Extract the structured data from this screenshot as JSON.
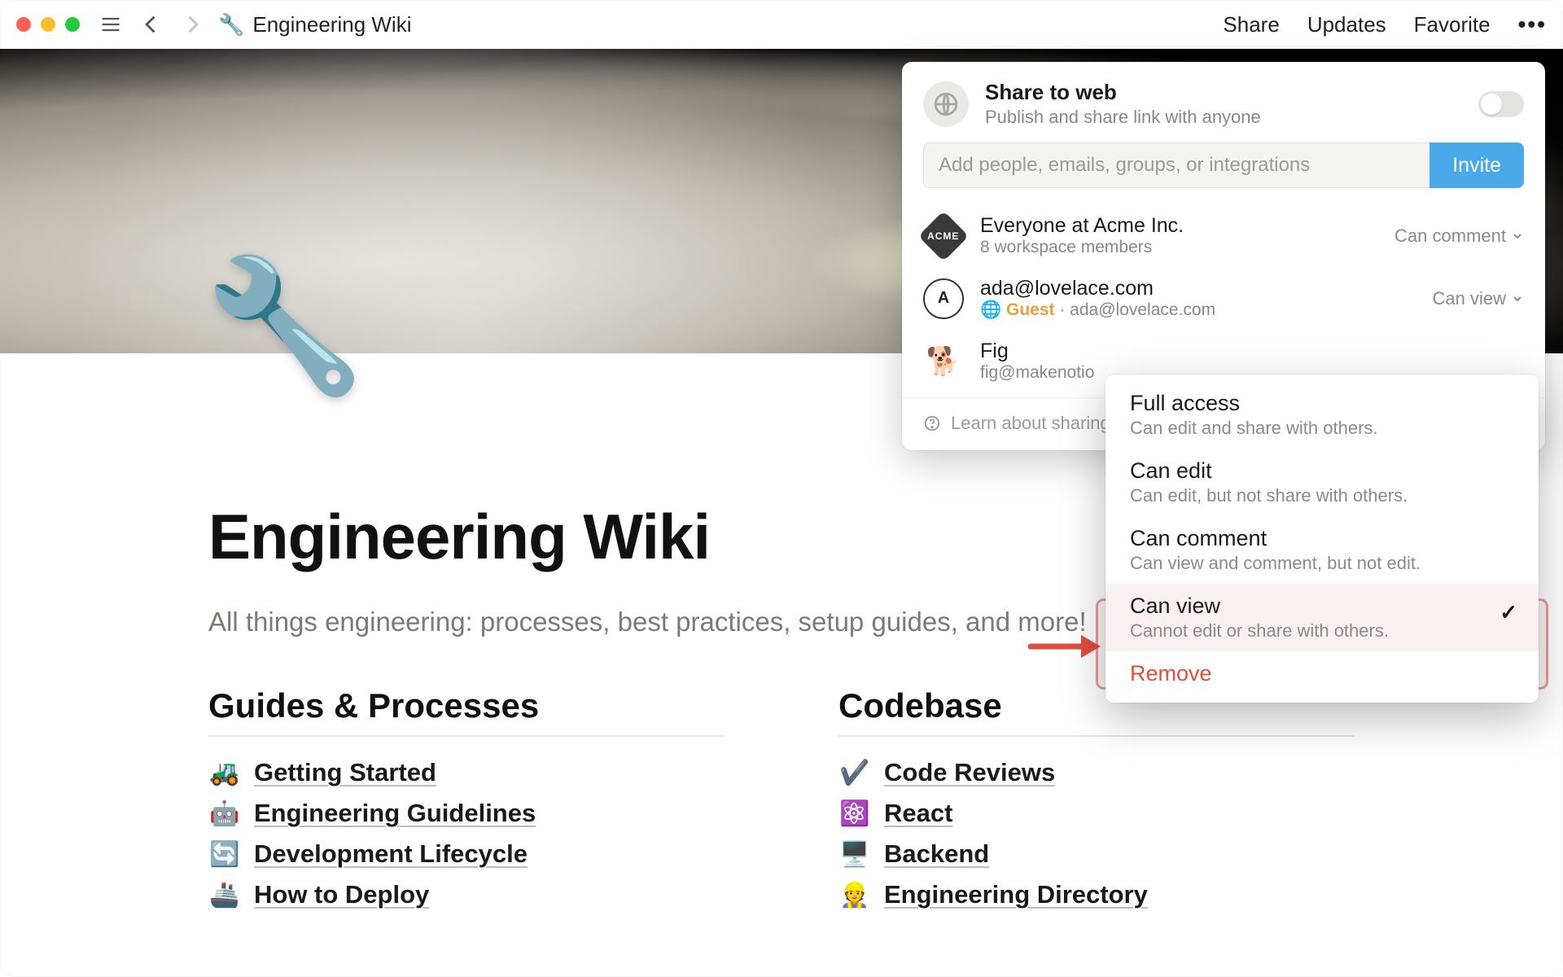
{
  "topbar": {
    "title": "Engineering Wiki",
    "icon": "🔧",
    "actions": {
      "share": "Share",
      "updates": "Updates",
      "favorite": "Favorite"
    }
  },
  "page": {
    "icon": "🔧",
    "title": "Engineering Wiki",
    "subtitle": "All things engineering: processes, best practices, setup guides, and more!",
    "columns": [
      {
        "heading": "Guides & Processes",
        "items": [
          {
            "emoji": "🚜",
            "label": "Getting Started"
          },
          {
            "emoji": "🤖",
            "label": "Engineering Guidelines"
          },
          {
            "emoji": "🔄",
            "label": "Development Lifecycle"
          },
          {
            "emoji": "🚢",
            "label": "How to Deploy"
          }
        ]
      },
      {
        "heading": "Codebase",
        "items": [
          {
            "emoji": "✔️",
            "label": "Code Reviews"
          },
          {
            "emoji": "⚛️",
            "label": "React"
          },
          {
            "emoji": "🖥️",
            "label": "Backend"
          },
          {
            "emoji": "👷",
            "label": "Engineering Directory"
          }
        ]
      }
    ]
  },
  "share": {
    "web": {
      "title": "Share to web",
      "subtitle": "Publish and share link with anyone",
      "enabled": false
    },
    "invite": {
      "placeholder": "Add people, emails, groups, or integrations",
      "button": "Invite"
    },
    "people": [
      {
        "avatar_type": "acme",
        "avatar_label": "ACME",
        "title": "Everyone at Acme Inc.",
        "subtitle": "8 workspace members",
        "permission": "Can comment"
      },
      {
        "avatar_type": "ring",
        "avatar_label": "A",
        "title": "ada@lovelace.com",
        "subtitle_guest": "Guest",
        "subtitle_sep": " · ",
        "subtitle_email": "ada@lovelace.com",
        "permission": "Can view"
      },
      {
        "avatar_type": "fig",
        "avatar_label": "🐕",
        "title": "Fig",
        "subtitle": "fig@makenotio",
        "permission": ""
      }
    ],
    "learn": "Learn about sharing"
  },
  "perm_menu": {
    "items": [
      {
        "title": "Full access",
        "subtitle": "Can edit and share with others."
      },
      {
        "title": "Can edit",
        "subtitle": "Can edit, but not share with others."
      },
      {
        "title": "Can comment",
        "subtitle": "Can view and comment, but not edit."
      },
      {
        "title": "Can view",
        "subtitle": "Cannot edit or share with others.",
        "selected": true
      }
    ],
    "remove": "Remove"
  }
}
